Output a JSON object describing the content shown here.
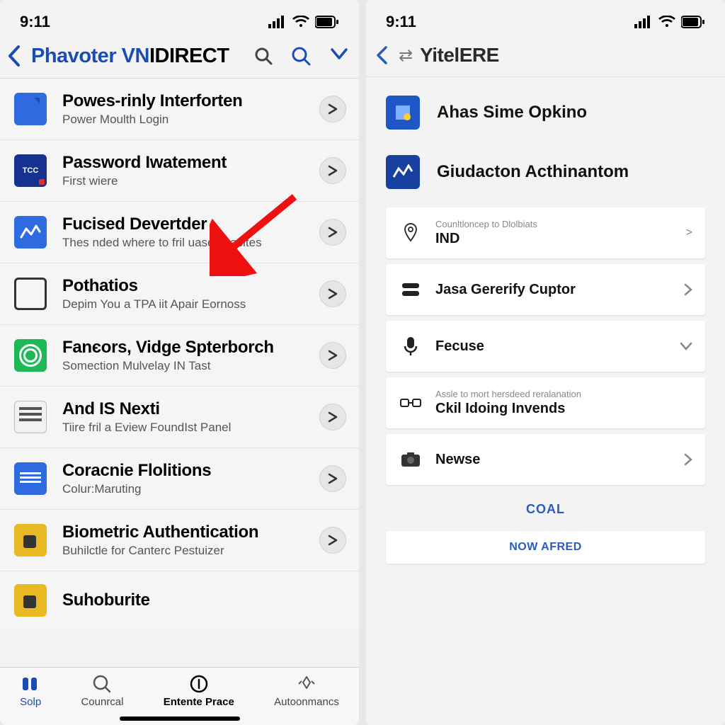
{
  "status": {
    "time": "9:11"
  },
  "left": {
    "nav": {
      "title_blue": "Phavoter VN",
      "title_black": "IDIRECT"
    },
    "items": [
      {
        "title": "Powes-rinly Interforten",
        "sub": "Power Moulth Login"
      },
      {
        "title": "Password Iwatement",
        "sub": "First wiere"
      },
      {
        "title": "Fucised Devertder",
        "sub": "Thes nded where to fril uase chasltes"
      },
      {
        "title": "Pothatios",
        "sub": "Depim You a TPA iit Apair Eornoss"
      },
      {
        "title": "Fanєors, Vidge Spterborch",
        "sub": "Somection Mulvelay IN Tast"
      },
      {
        "title": "And IS Nexti",
        "sub": "Tiire fril a Eview FoundIst Panel"
      },
      {
        "title": "Coracnie Flolitions",
        "sub": "Colur:Maruting"
      },
      {
        "title": "Biometric Authentication",
        "sub": "Buhilctle for Canterc Pestuizer"
      },
      {
        "title": "Suhoburite",
        "sub": ""
      }
    ],
    "tabs": [
      {
        "label": "Solp"
      },
      {
        "label": "Counrcal"
      },
      {
        "label": "Entente Prace"
      },
      {
        "label": "Autoonmancs"
      }
    ]
  },
  "right": {
    "nav": {
      "title_pre": "·",
      "title_main": "YitelERE"
    },
    "heads": [
      {
        "title": "Ahas Sime Opkino"
      },
      {
        "title": "Giudacton Acthinantom"
      }
    ],
    "cards": [
      {
        "sup": "Counltloncep to Dlolbiats",
        "label": "IND",
        "chev": ">"
      },
      {
        "sup": "",
        "label": "Jasa Gererify Cuptor",
        "chev": ">"
      },
      {
        "sup": "",
        "label": "Fecuse",
        "chev": "v"
      },
      {
        "sup": "Assle to mort hersdeed reralanation",
        "label": "Ckil Idoing Invends",
        "chev": ""
      },
      {
        "sup": "",
        "label": "Newse",
        "chev": ">"
      }
    ],
    "action1": "COAL",
    "action2": "NOW AFRED"
  }
}
